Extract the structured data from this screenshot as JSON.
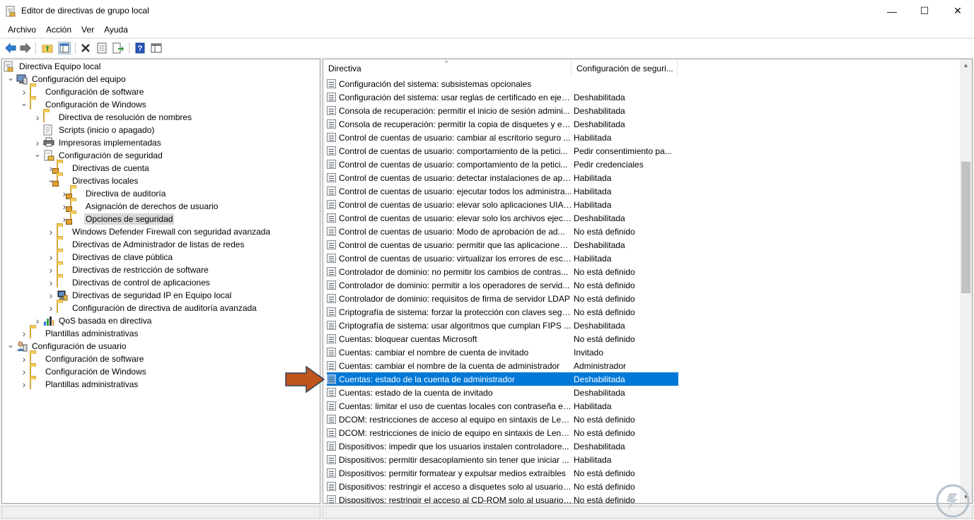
{
  "window": {
    "title": "Editor de directivas de grupo local",
    "minimize_glyph": "—",
    "maximize_glyph": "☐",
    "close_glyph": "✕"
  },
  "menu": [
    "Archivo",
    "Acción",
    "Ver",
    "Ayuda"
  ],
  "toolbar": {
    "icons": [
      "back-arrow-icon",
      "forward-arrow-icon",
      "up-folder-icon",
      "show-hide-tree-icon",
      "delete-icon",
      "properties-icon",
      "export-list-icon",
      "help-icon",
      "console-view-icon"
    ]
  },
  "tree": [
    {
      "label": "Directiva Equipo local",
      "level": 0,
      "expander": "",
      "icon": "policy-document-icon"
    },
    {
      "label": "Configuración del equipo",
      "level": 1,
      "expander": "down",
      "icon": "computer-icon"
    },
    {
      "label": "Configuración de software",
      "level": 2,
      "expander": "right",
      "icon": "folder-icon"
    },
    {
      "label": "Configuración de Windows",
      "level": 2,
      "expander": "down",
      "icon": "folder-icon"
    },
    {
      "label": "Directiva de resolución de nombres",
      "level": 3,
      "expander": "right",
      "icon": "folder-icon"
    },
    {
      "label": "Scripts (inicio o apagado)",
      "level": 3,
      "expander": "",
      "icon": "script-icon"
    },
    {
      "label": "Impresoras implementadas",
      "level": 3,
      "expander": "right",
      "icon": "printer-icon"
    },
    {
      "label": "Configuración de seguridad",
      "level": 3,
      "expander": "down",
      "icon": "security-settings-icon"
    },
    {
      "label": "Directivas de cuenta",
      "level": 4,
      "expander": "right",
      "icon": "locked-folder-icon"
    },
    {
      "label": "Directivas locales",
      "level": 4,
      "expander": "down",
      "icon": "locked-folder-icon"
    },
    {
      "label": "Directiva de auditoría",
      "level": 5,
      "expander": "right",
      "icon": "locked-folder-icon"
    },
    {
      "label": "Asignación de derechos de usuario",
      "level": 5,
      "expander": "right",
      "icon": "locked-folder-icon"
    },
    {
      "label": "Opciones de seguridad",
      "level": 5,
      "expander": "right",
      "icon": "locked-folder-icon",
      "selected": true
    },
    {
      "label": "Windows Defender Firewall con seguridad avanzada",
      "level": 4,
      "expander": "right",
      "icon": "folder-icon"
    },
    {
      "label": "Directivas de Administrador de listas de redes",
      "level": 4,
      "expander": "",
      "icon": "folder-icon"
    },
    {
      "label": "Directivas de clave pública",
      "level": 4,
      "expander": "right",
      "icon": "folder-icon"
    },
    {
      "label": "Directivas de restricción de software",
      "level": 4,
      "expander": "right",
      "icon": "folder-icon"
    },
    {
      "label": "Directivas de control de aplicaciones",
      "level": 4,
      "expander": "right",
      "icon": "folder-icon"
    },
    {
      "label": "Directivas de seguridad IP en Equipo local",
      "level": 4,
      "expander": "right",
      "icon": "ip-security-icon"
    },
    {
      "label": "Configuración de directiva de auditoría avanzada",
      "level": 4,
      "expander": "right",
      "icon": "folder-icon"
    },
    {
      "label": "QoS basada en directiva",
      "level": 3,
      "expander": "right",
      "icon": "qos-chart-icon"
    },
    {
      "label": "Plantillas administrativas",
      "level": 2,
      "expander": "right",
      "icon": "folder-icon"
    },
    {
      "label": "Configuración de usuario",
      "level": 1,
      "expander": "down",
      "icon": "user-icon"
    },
    {
      "label": "Configuración de software",
      "level": 2,
      "expander": "right",
      "icon": "folder-icon"
    },
    {
      "label": "Configuración de Windows",
      "level": 2,
      "expander": "right",
      "icon": "folder-icon"
    },
    {
      "label": "Plantillas administrativas",
      "level": 2,
      "expander": "right",
      "icon": "folder-icon"
    }
  ],
  "list": {
    "columns": [
      "Directiva",
      "Configuración de seguri..."
    ],
    "rows": [
      {
        "policy": "Configuración del sistema: subsistemas opcionales",
        "setting": ""
      },
      {
        "policy": "Configuración del sistema: usar reglas de certificado en ejec...",
        "setting": "Deshabilitada"
      },
      {
        "policy": "Consola de recuperación: permitir el inicio de sesión admini...",
        "setting": "Deshabilitada"
      },
      {
        "policy": "Consola de recuperación: permitir la copia de disquetes y el ...",
        "setting": "Deshabilitada"
      },
      {
        "policy": "Control de cuentas de usuario: cambiar al escritorio seguro ...",
        "setting": "Habilitada"
      },
      {
        "policy": "Control de cuentas de usuario: comportamiento de la petici...",
        "setting": "Pedir consentimiento pa..."
      },
      {
        "policy": "Control de cuentas de usuario: comportamiento de la petici...",
        "setting": "Pedir credenciales"
      },
      {
        "policy": "Control de cuentas de usuario: detectar instalaciones de apli...",
        "setting": "Habilitada"
      },
      {
        "policy": "Control de cuentas de usuario: ejecutar todos los administra...",
        "setting": "Habilitada"
      },
      {
        "policy": "Control de cuentas de usuario: elevar solo aplicaciones UIAc...",
        "setting": "Habilitada"
      },
      {
        "policy": "Control de cuentas de usuario: elevar solo los archivos ejecu...",
        "setting": "Deshabilitada"
      },
      {
        "policy": "Control de cuentas de usuario: Modo de aprobación de ad...",
        "setting": "No está definido"
      },
      {
        "policy": "Control de cuentas de usuario: permitir que las aplicaciones ...",
        "setting": "Deshabilitada"
      },
      {
        "policy": "Control de cuentas de usuario: virtualizar los errores de escri...",
        "setting": "Habilitada"
      },
      {
        "policy": "Controlador de dominio: no permitir los cambios de contras...",
        "setting": "No está definido"
      },
      {
        "policy": "Controlador de dominio: permitir a los operadores de servid...",
        "setting": "No está definido"
      },
      {
        "policy": "Controlador de dominio: requisitos de firma de servidor LDAP",
        "setting": "No está definido"
      },
      {
        "policy": "Criptografía de sistema: forzar la protección con claves segu...",
        "setting": "No está definido"
      },
      {
        "policy": "Criptografía de sistema: usar algoritmos que cumplan FIPS ...",
        "setting": "Deshabilitada"
      },
      {
        "policy": "Cuentas: bloquear cuentas Microsoft",
        "setting": "No está definido"
      },
      {
        "policy": "Cuentas: cambiar el nombre de cuenta de invitado",
        "setting": "Invitado"
      },
      {
        "policy": "Cuentas: cambiar el nombre de la cuenta de administrador",
        "setting": "Administrador"
      },
      {
        "policy": "Cuentas: estado de la cuenta de administrador",
        "setting": "Deshabilitada",
        "selected": true
      },
      {
        "policy": "Cuentas: estado de la cuenta de invitado",
        "setting": "Deshabilitada"
      },
      {
        "policy": "Cuentas: limitar el uso de cuentas locales con contraseña en...",
        "setting": "Habilitada"
      },
      {
        "policy": "DCOM: restricciones de acceso al equipo en sintaxis de Len...",
        "setting": "No está definido"
      },
      {
        "policy": "DCOM: restricciones de inicio de equipo en sintaxis de Leng...",
        "setting": "No está definido"
      },
      {
        "policy": "Dispositivos: impedir que los usuarios instalen controladore...",
        "setting": "Deshabilitada"
      },
      {
        "policy": "Dispositivos: permitir desacoplamiento sin tener que iniciar ...",
        "setting": "Habilitada"
      },
      {
        "policy": "Dispositivos: permitir formatear y expulsar medios extraíbles",
        "setting": "No está definido"
      },
      {
        "policy": "Dispositivos: restringir el acceso a disquetes solo al usuario c...",
        "setting": "No está definido"
      },
      {
        "policy": "Dispositivos: restringir el acceso al CD-ROM solo al usuario ...",
        "setting": "No está definido"
      }
    ]
  },
  "colors": {
    "selection": "#0078d7",
    "arrow_annotation": "#c0561c"
  }
}
